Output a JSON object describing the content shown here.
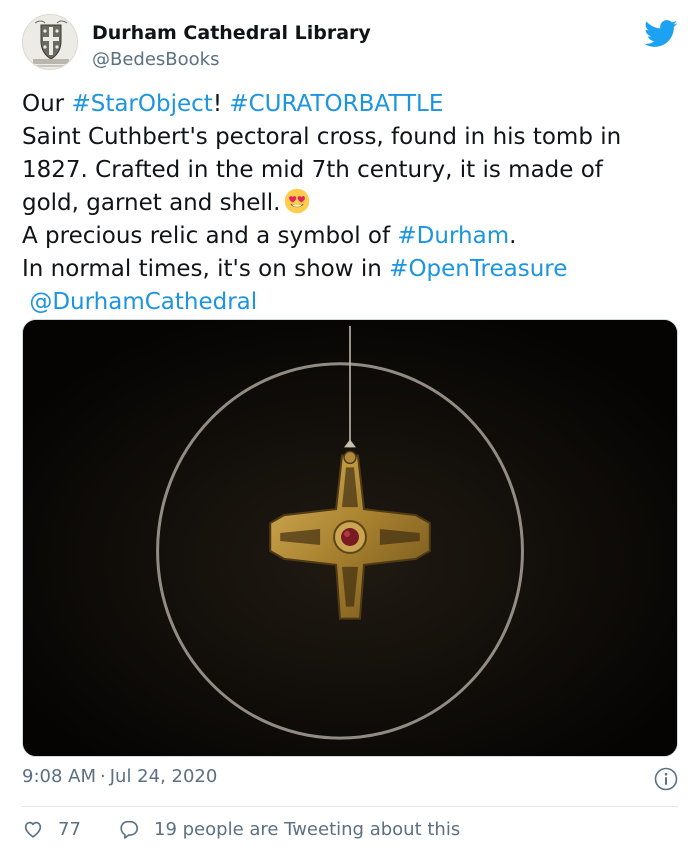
{
  "author": {
    "display_name": "Durham Cathedral Library",
    "handle": "@BedesBooks"
  },
  "tweet": {
    "line1_prefix": "Our ",
    "hashtag_starobject": "#StarObject",
    "line1_mid": "! ",
    "hashtag_curatorbattle": "#CURATORBATTLE",
    "line2": "Saint Cuthbert's pectoral cross, found in his tomb in",
    "line3": "1827. Crafted in the mid 7th century, it is made of",
    "line4": "gold, garnet and shell.",
    "line5_prefix": "A precious relic and a symbol of ",
    "hashtag_durham": "#Durham",
    "line5_suffix": ".",
    "line6_prefix": "In normal times, it's on show in ",
    "hashtag_opentreasure": "#OpenTreasure",
    "mention": "@DurhamCathedral"
  },
  "emoji": "heart-eyes-emoji",
  "media": {
    "icon": "pectoral-cross-photo"
  },
  "meta": {
    "time": "9:08 AM",
    "separator": "·",
    "date": "Jul 24, 2020"
  },
  "engagement": {
    "likes": "77",
    "conversation": "19 people are Tweeting about this"
  },
  "colors": {
    "link": "#1b95e0",
    "twitter_blue": "#1da1f2",
    "secondary_text": "#5b7083",
    "like_icon": "#5b7083"
  },
  "icons": {
    "brand": "twitter-bird-icon",
    "info": "info-icon",
    "like": "heart-icon",
    "reply": "speech-bubble-icon"
  }
}
